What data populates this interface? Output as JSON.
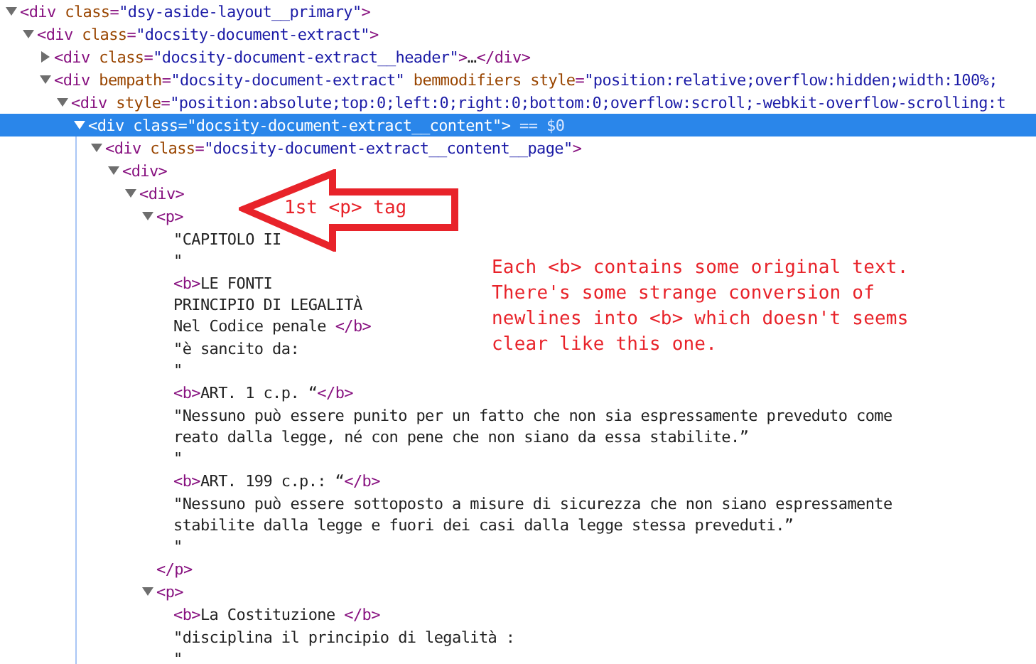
{
  "dom_tree": [
    {
      "selected": false,
      "expanded": true,
      "parts": [
        {
          "kind": "tag",
          "text": "<div "
        },
        {
          "kind": "attr",
          "text": "class"
        },
        {
          "kind": "tag",
          "text": "="
        },
        {
          "kind": "value",
          "text": "\"dsy-aside-layout__primary\""
        },
        {
          "kind": "tag",
          "text": ">"
        }
      ],
      "children": [
        {
          "selected": false,
          "expanded": true,
          "parts": [
            {
              "kind": "tag",
              "text": "<div "
            },
            {
              "kind": "attr",
              "text": "class"
            },
            {
              "kind": "tag",
              "text": "="
            },
            {
              "kind": "value",
              "text": "\"docsity-document-extract\""
            },
            {
              "kind": "tag",
              "text": ">"
            }
          ],
          "children": [
            {
              "selected": false,
              "expanded": false,
              "parts": [
                {
                  "kind": "tag",
                  "text": "<div "
                },
                {
                  "kind": "attr",
                  "text": "class"
                },
                {
                  "kind": "tag",
                  "text": "="
                },
                {
                  "kind": "value",
                  "text": "\"docsity-document-extract__header\""
                },
                {
                  "kind": "tag",
                  "text": ">"
                },
                {
                  "kind": "text",
                  "text": "…"
                },
                {
                  "kind": "tag",
                  "text": "</div>"
                }
              ]
            },
            {
              "selected": false,
              "expanded": true,
              "parts": [
                {
                  "kind": "tag",
                  "text": "<div "
                },
                {
                  "kind": "attr",
                  "text": "bempath"
                },
                {
                  "kind": "tag",
                  "text": "="
                },
                {
                  "kind": "value",
                  "text": "\"docsity-document-extract\""
                },
                {
                  "kind": "attr",
                  "text": " bemmodifiers style"
                },
                {
                  "kind": "tag",
                  "text": "="
                },
                {
                  "kind": "value",
                  "text": "\"position:relative;overflow:hidden;width:100%;"
                }
              ],
              "children": [
                {
                  "selected": false,
                  "expanded": true,
                  "parts": [
                    {
                      "kind": "tag",
                      "text": "<div "
                    },
                    {
                      "kind": "attr",
                      "text": "style"
                    },
                    {
                      "kind": "tag",
                      "text": "="
                    },
                    {
                      "kind": "value",
                      "text": "\"position:absolute;top:0;left:0;right:0;bottom:0;overflow:scroll;-webkit-overflow-scrolling:t"
                    }
                  ],
                  "children": [
                    {
                      "selected": true,
                      "expanded": true,
                      "parts": [
                        {
                          "kind": "tag",
                          "text": "<div "
                        },
                        {
                          "kind": "attr",
                          "text": "class"
                        },
                        {
                          "kind": "tag",
                          "text": "="
                        },
                        {
                          "kind": "value",
                          "text": "\"docsity-document-extract__content\""
                        },
                        {
                          "kind": "tag",
                          "text": ">"
                        },
                        {
                          "kind": "hint",
                          "text": " == $0"
                        }
                      ],
                      "children": [
                        {
                          "selected": false,
                          "expanded": true,
                          "parts": [
                            {
                              "kind": "tag",
                              "text": "<div "
                            },
                            {
                              "kind": "attr",
                              "text": "class"
                            },
                            {
                              "kind": "tag",
                              "text": "="
                            },
                            {
                              "kind": "value",
                              "text": "\"docsity-document-extract__content__page\""
                            },
                            {
                              "kind": "tag",
                              "text": ">"
                            }
                          ],
                          "children": [
                            {
                              "selected": false,
                              "expanded": true,
                              "parts": [
                                {
                                  "kind": "tag",
                                  "text": "<div>"
                                }
                              ],
                              "children": [
                                {
                                  "selected": false,
                                  "expanded": true,
                                  "parts": [
                                    {
                                      "kind": "tag",
                                      "text": "<div>"
                                    }
                                  ],
                                  "children": [
                                    {
                                      "selected": false,
                                      "expanded": true,
                                      "parts": [
                                        {
                                          "kind": "tag",
                                          "text": "<p>"
                                        }
                                      ],
                                      "close": [
                                        {
                                          "kind": "tag",
                                          "text": "</p>"
                                        }
                                      ],
                                      "children": [
                                        {
                                          "selected": false,
                                          "parts": [
                                            {
                                              "kind": "text",
                                              "text": "\"CAPITOLO II\n\""
                                            }
                                          ]
                                        },
                                        {
                                          "selected": false,
                                          "parts": [
                                            {
                                              "kind": "tag",
                                              "text": "<b>"
                                            },
                                            {
                                              "kind": "text",
                                              "text": "LE FONTI\nPRINCIPIO DI LEGALITÀ\nNel Codice penale "
                                            },
                                            {
                                              "kind": "tag",
                                              "text": "</b>"
                                            }
                                          ]
                                        },
                                        {
                                          "selected": false,
                                          "parts": [
                                            {
                                              "kind": "text",
                                              "text": "\"è sancito da:\n\""
                                            }
                                          ]
                                        },
                                        {
                                          "selected": false,
                                          "parts": [
                                            {
                                              "kind": "tag",
                                              "text": "<b>"
                                            },
                                            {
                                              "kind": "text",
                                              "text": "ART. 1 c.p. “"
                                            },
                                            {
                                              "kind": "tag",
                                              "text": "</b>"
                                            }
                                          ]
                                        },
                                        {
                                          "selected": false,
                                          "parts": [
                                            {
                                              "kind": "text",
                                              "text": "\"Nessuno può essere punito per un fatto che non sia espressamente preveduto come\nreato dalla legge, né con pene che non siano da essa stabilite.”\n\""
                                            }
                                          ]
                                        },
                                        {
                                          "selected": false,
                                          "parts": [
                                            {
                                              "kind": "tag",
                                              "text": "<b>"
                                            },
                                            {
                                              "kind": "text",
                                              "text": "ART. 199 c.p.: “"
                                            },
                                            {
                                              "kind": "tag",
                                              "text": "</b>"
                                            }
                                          ]
                                        },
                                        {
                                          "selected": false,
                                          "parts": [
                                            {
                                              "kind": "text",
                                              "text": "\"Nessuno può essere sottoposto a misure di sicurezza che non siano espressamente\nstabilite dalla legge e fuori dei casi dalla legge stessa preveduti.”\n\""
                                            }
                                          ]
                                        }
                                      ]
                                    },
                                    {
                                      "selected": false,
                                      "expanded": true,
                                      "parts": [
                                        {
                                          "kind": "tag",
                                          "text": "<p>"
                                        }
                                      ],
                                      "children": [
                                        {
                                          "selected": false,
                                          "parts": [
                                            {
                                              "kind": "tag",
                                              "text": "<b>"
                                            },
                                            {
                                              "kind": "text",
                                              "text": "La Costituzione "
                                            },
                                            {
                                              "kind": "tag",
                                              "text": "</b>"
                                            }
                                          ]
                                        },
                                        {
                                          "selected": false,
                                          "parts": [
                                            {
                                              "kind": "text",
                                              "text": "\"disciplina il principio di legalità :\n\""
                                            }
                                          ]
                                        }
                                      ]
                                    }
                                  ]
                                }
                              ]
                            }
                          ]
                        }
                      ]
                    }
                  ]
                }
              ]
            }
          ]
        }
      ]
    }
  ],
  "annotations": [
    {
      "kind": "arrow",
      "text": "1st <p> tag"
    },
    {
      "kind": "note",
      "text": "Each <b> contains some original text.\nThere's some strange conversion of\nnewlines into <b> which doesn't seems\nclear like this one."
    }
  ]
}
